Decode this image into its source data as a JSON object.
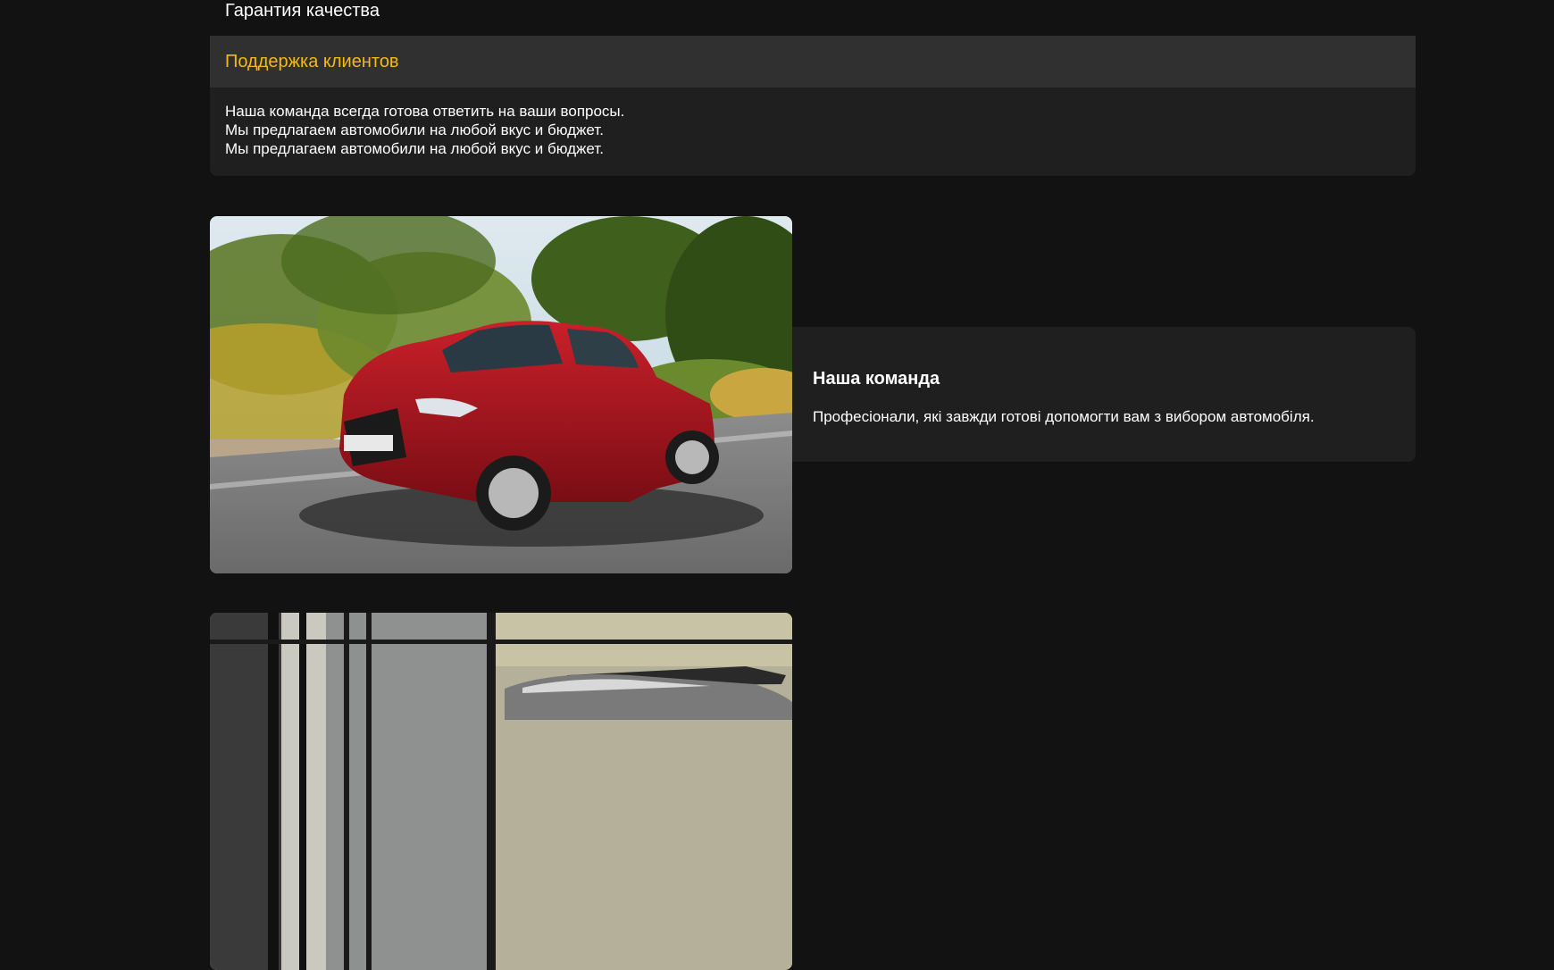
{
  "accordion": {
    "prev_item_title": "Гарантия качества",
    "open_item": {
      "title": "Поддержка клиентов",
      "lines": [
        "Наша команда всегда готова ответить на ваши вопросы.",
        "Мы предлагаем автомобили на любой вкус и бюджет.",
        "Мы предлагаем автомобили на любой вкус и бюджет."
      ]
    }
  },
  "features": [
    {
      "title": "Наша команда",
      "text": "Професіонали, які завжди готові допомогти вам з вибором автомобіля.",
      "image": "red-suv-photo"
    },
    {
      "title": "",
      "text": "",
      "image": "silver-sports-car-photo"
    }
  ],
  "colors": {
    "background": "#121212",
    "accent": "#f5b914",
    "card": "#1f1f1f",
    "header": "#303030"
  }
}
